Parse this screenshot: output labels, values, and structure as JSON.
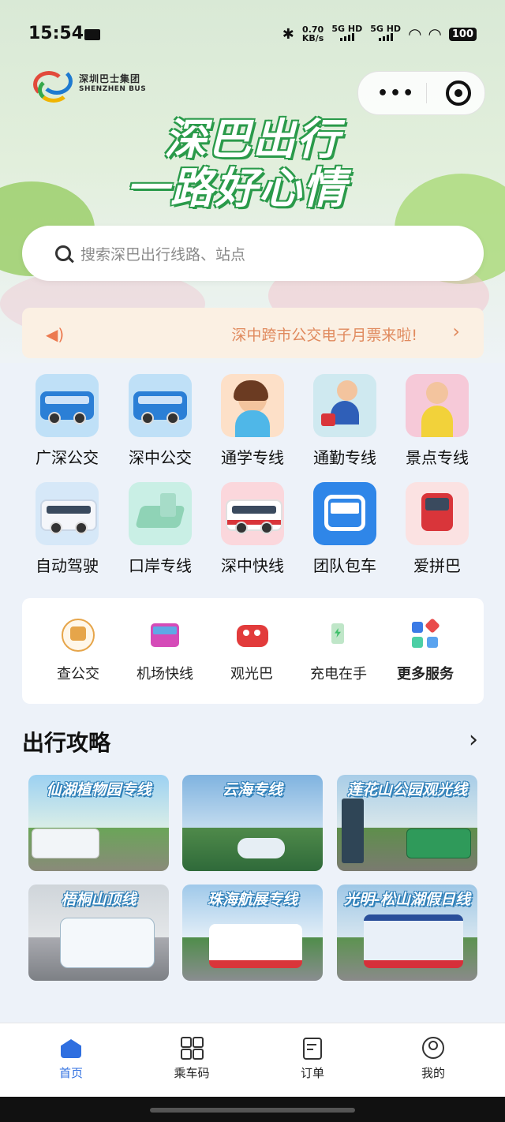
{
  "status_bar": {
    "time": "15:54",
    "net_speed_value": "0.70",
    "net_speed_unit": "KB/s",
    "sim1": "5G HD",
    "sim2": "5G HD",
    "battery": "100"
  },
  "header": {
    "logo_cn": "深圳巴士集团",
    "logo_en": "SHENZHEN BUS",
    "slogan_line1": "深巴出行",
    "slogan_line2": "一路好心情"
  },
  "search": {
    "placeholder": "搜索深巴出行线路、站点"
  },
  "notice": {
    "text": "深中跨市公交电子月票来啦!"
  },
  "quick_grid": [
    {
      "label": "广深公交",
      "icon": "bus-blue-icon"
    },
    {
      "label": "深中公交",
      "icon": "bus-blue-icon"
    },
    {
      "label": "通学专线",
      "icon": "student-icon"
    },
    {
      "label": "通勤专线",
      "icon": "commuter-icon"
    },
    {
      "label": "景点专线",
      "icon": "tourist-icon"
    },
    {
      "label": "自动驾驶",
      "icon": "autonomous-bus-icon"
    },
    {
      "label": "口岸专线",
      "icon": "port-icon"
    },
    {
      "label": "深中快线",
      "icon": "express-bus-icon"
    },
    {
      "label": "团队包车",
      "icon": "charter-bus-icon"
    },
    {
      "label": "爱拼巴",
      "icon": "carpool-bus-icon"
    }
  ],
  "services": [
    {
      "label": "查公交",
      "icon": "bus-search-icon"
    },
    {
      "label": "机场快线",
      "icon": "airport-bus-icon"
    },
    {
      "label": "观光巴",
      "icon": "sightseeing-bus-icon"
    },
    {
      "label": "充电在手",
      "icon": "charging-icon"
    },
    {
      "label": "更多服务",
      "icon": "more-services-icon"
    }
  ],
  "guide": {
    "title": "出行攻略",
    "cards": [
      {
        "title": "仙湖植物园专线"
      },
      {
        "title": "云海专线"
      },
      {
        "title": "莲花山公园观光线"
      },
      {
        "title": "梧桐山顶线"
      },
      {
        "title": "珠海航展专线"
      },
      {
        "title": "光明-松山湖假日线"
      }
    ]
  },
  "tabbar": [
    {
      "label": "首页",
      "icon": "home-icon",
      "active": true
    },
    {
      "label": "乘车码",
      "icon": "qr-code-icon",
      "active": false
    },
    {
      "label": "订单",
      "icon": "orders-icon",
      "active": false
    },
    {
      "label": "我的",
      "icon": "profile-icon",
      "active": false
    }
  ],
  "colors": {
    "accent": "#2f6fe0",
    "notice_text": "#e08a5e",
    "notice_bg": "#fbf0e3",
    "slogan_green": "#2a9a4a"
  }
}
